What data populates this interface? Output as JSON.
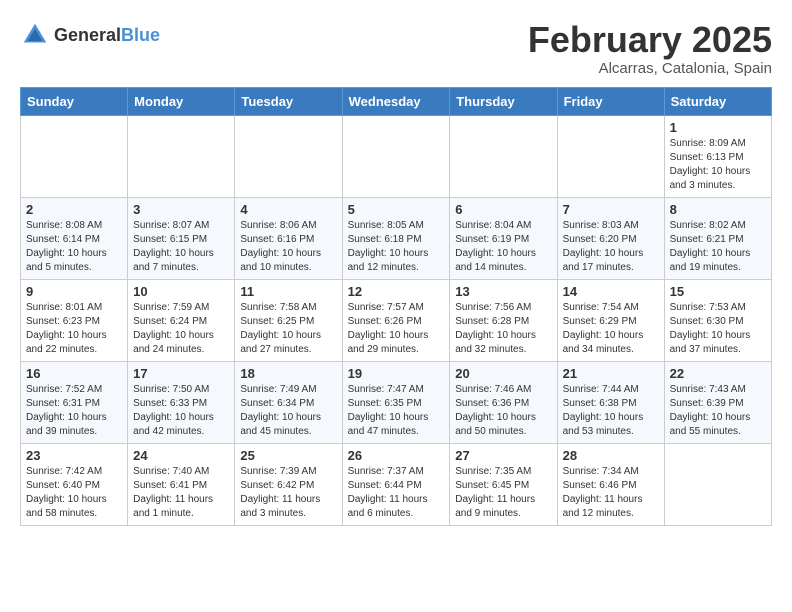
{
  "logo": {
    "text_general": "General",
    "text_blue": "Blue"
  },
  "header": {
    "month_year": "February 2025",
    "location": "Alcarras, Catalonia, Spain"
  },
  "weekdays": [
    "Sunday",
    "Monday",
    "Tuesday",
    "Wednesday",
    "Thursday",
    "Friday",
    "Saturday"
  ],
  "weeks": [
    [
      {
        "day": "",
        "info": ""
      },
      {
        "day": "",
        "info": ""
      },
      {
        "day": "",
        "info": ""
      },
      {
        "day": "",
        "info": ""
      },
      {
        "day": "",
        "info": ""
      },
      {
        "day": "",
        "info": ""
      },
      {
        "day": "1",
        "info": "Sunrise: 8:09 AM\nSunset: 6:13 PM\nDaylight: 10 hours\nand 3 minutes."
      }
    ],
    [
      {
        "day": "2",
        "info": "Sunrise: 8:08 AM\nSunset: 6:14 PM\nDaylight: 10 hours\nand 5 minutes."
      },
      {
        "day": "3",
        "info": "Sunrise: 8:07 AM\nSunset: 6:15 PM\nDaylight: 10 hours\nand 7 minutes."
      },
      {
        "day": "4",
        "info": "Sunrise: 8:06 AM\nSunset: 6:16 PM\nDaylight: 10 hours\nand 10 minutes."
      },
      {
        "day": "5",
        "info": "Sunrise: 8:05 AM\nSunset: 6:18 PM\nDaylight: 10 hours\nand 12 minutes."
      },
      {
        "day": "6",
        "info": "Sunrise: 8:04 AM\nSunset: 6:19 PM\nDaylight: 10 hours\nand 14 minutes."
      },
      {
        "day": "7",
        "info": "Sunrise: 8:03 AM\nSunset: 6:20 PM\nDaylight: 10 hours\nand 17 minutes."
      },
      {
        "day": "8",
        "info": "Sunrise: 8:02 AM\nSunset: 6:21 PM\nDaylight: 10 hours\nand 19 minutes."
      }
    ],
    [
      {
        "day": "9",
        "info": "Sunrise: 8:01 AM\nSunset: 6:23 PM\nDaylight: 10 hours\nand 22 minutes."
      },
      {
        "day": "10",
        "info": "Sunrise: 7:59 AM\nSunset: 6:24 PM\nDaylight: 10 hours\nand 24 minutes."
      },
      {
        "day": "11",
        "info": "Sunrise: 7:58 AM\nSunset: 6:25 PM\nDaylight: 10 hours\nand 27 minutes."
      },
      {
        "day": "12",
        "info": "Sunrise: 7:57 AM\nSunset: 6:26 PM\nDaylight: 10 hours\nand 29 minutes."
      },
      {
        "day": "13",
        "info": "Sunrise: 7:56 AM\nSunset: 6:28 PM\nDaylight: 10 hours\nand 32 minutes."
      },
      {
        "day": "14",
        "info": "Sunrise: 7:54 AM\nSunset: 6:29 PM\nDaylight: 10 hours\nand 34 minutes."
      },
      {
        "day": "15",
        "info": "Sunrise: 7:53 AM\nSunset: 6:30 PM\nDaylight: 10 hours\nand 37 minutes."
      }
    ],
    [
      {
        "day": "16",
        "info": "Sunrise: 7:52 AM\nSunset: 6:31 PM\nDaylight: 10 hours\nand 39 minutes."
      },
      {
        "day": "17",
        "info": "Sunrise: 7:50 AM\nSunset: 6:33 PM\nDaylight: 10 hours\nand 42 minutes."
      },
      {
        "day": "18",
        "info": "Sunrise: 7:49 AM\nSunset: 6:34 PM\nDaylight: 10 hours\nand 45 minutes."
      },
      {
        "day": "19",
        "info": "Sunrise: 7:47 AM\nSunset: 6:35 PM\nDaylight: 10 hours\nand 47 minutes."
      },
      {
        "day": "20",
        "info": "Sunrise: 7:46 AM\nSunset: 6:36 PM\nDaylight: 10 hours\nand 50 minutes."
      },
      {
        "day": "21",
        "info": "Sunrise: 7:44 AM\nSunset: 6:38 PM\nDaylight: 10 hours\nand 53 minutes."
      },
      {
        "day": "22",
        "info": "Sunrise: 7:43 AM\nSunset: 6:39 PM\nDaylight: 10 hours\nand 55 minutes."
      }
    ],
    [
      {
        "day": "23",
        "info": "Sunrise: 7:42 AM\nSunset: 6:40 PM\nDaylight: 10 hours\nand 58 minutes."
      },
      {
        "day": "24",
        "info": "Sunrise: 7:40 AM\nSunset: 6:41 PM\nDaylight: 11 hours\nand 1 minute."
      },
      {
        "day": "25",
        "info": "Sunrise: 7:39 AM\nSunset: 6:42 PM\nDaylight: 11 hours\nand 3 minutes."
      },
      {
        "day": "26",
        "info": "Sunrise: 7:37 AM\nSunset: 6:44 PM\nDaylight: 11 hours\nand 6 minutes."
      },
      {
        "day": "27",
        "info": "Sunrise: 7:35 AM\nSunset: 6:45 PM\nDaylight: 11 hours\nand 9 minutes."
      },
      {
        "day": "28",
        "info": "Sunrise: 7:34 AM\nSunset: 6:46 PM\nDaylight: 11 hours\nand 12 minutes."
      },
      {
        "day": "",
        "info": ""
      }
    ]
  ]
}
